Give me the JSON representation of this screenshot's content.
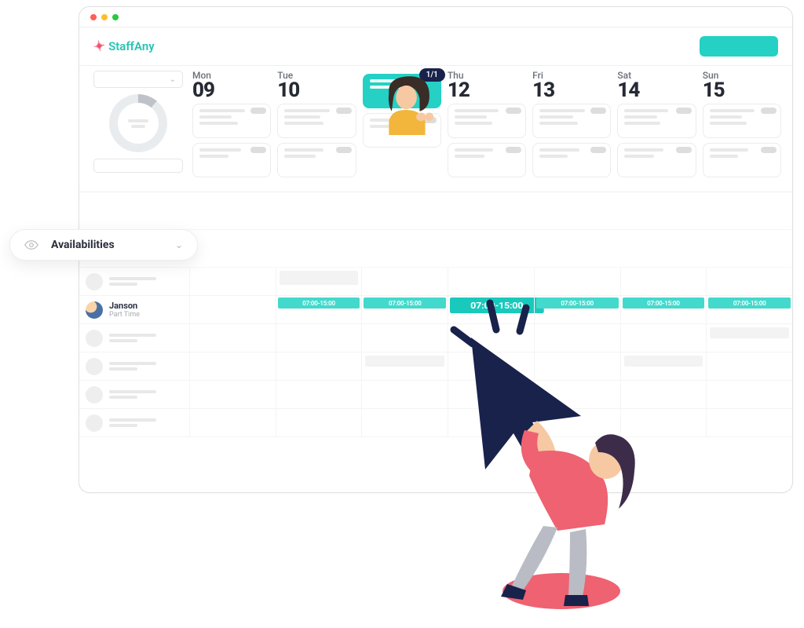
{
  "brand": {
    "name": "StaffAny"
  },
  "dropdown": {
    "label": "Availabilities"
  },
  "calendar": {
    "days": [
      {
        "dow": "Mon",
        "num": "09"
      },
      {
        "dow": "Tue",
        "num": "10"
      },
      {
        "dow": "",
        "num": ""
      },
      {
        "dow": "Thu",
        "num": "12"
      },
      {
        "dow": "Fri",
        "num": "13"
      },
      {
        "dow": "Sat",
        "num": "14"
      },
      {
        "dow": "Sun",
        "num": "15"
      }
    ],
    "badge": "1/1"
  },
  "staff": {
    "featured": {
      "name": "Janson",
      "role": "Part Time"
    },
    "slots": {
      "small": "07:00-15:00",
      "big": "07:00-15:00"
    }
  },
  "colors": {
    "accent": "#24d1c4",
    "dark": "#19224b",
    "coral": "#ef6271"
  }
}
